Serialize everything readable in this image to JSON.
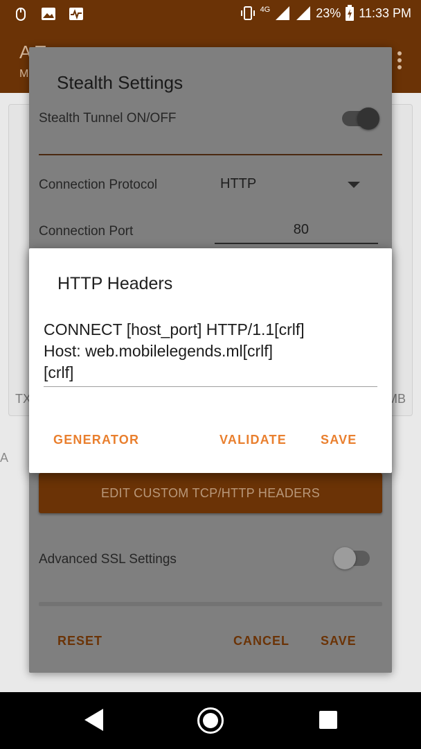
{
  "status_bar": {
    "signal_label": "4G",
    "battery": "23%",
    "time": "11:33 PM"
  },
  "app_bar": {
    "title": "A  T",
    "subtitle": "M"
  },
  "background": {
    "tx_label": "TX",
    "mb_label": "MB",
    "image_alt": "A"
  },
  "stealth_dialog": {
    "title": "Stealth Settings",
    "tunnel_label": "Stealth Tunnel ON/OFF",
    "tunnel_on": true,
    "protocol_label": "Connection Protocol",
    "protocol_value": "HTTP",
    "port_label": "Connection Port",
    "port_value": "80",
    "edit_headers_button": "EDIT CUSTOM TCP/HTTP HEADERS",
    "ssl_label": "Advanced SSL Settings",
    "ssl_on": false,
    "reset_button": "RESET",
    "cancel_button": "CANCEL",
    "save_button": "SAVE"
  },
  "http_dialog": {
    "title": "HTTP Headers",
    "headers_text": "CONNECT [host_port] HTTP/1.1[crlf]\nHost: web.mobilelegends.ml[crlf]\n[crlf]",
    "generator_button": "GENERATOR",
    "validate_button": "VALIDATE",
    "save_button": "SAVE"
  },
  "colors": {
    "accent": "#e97f2e",
    "primary_dark": "#6b3306"
  }
}
